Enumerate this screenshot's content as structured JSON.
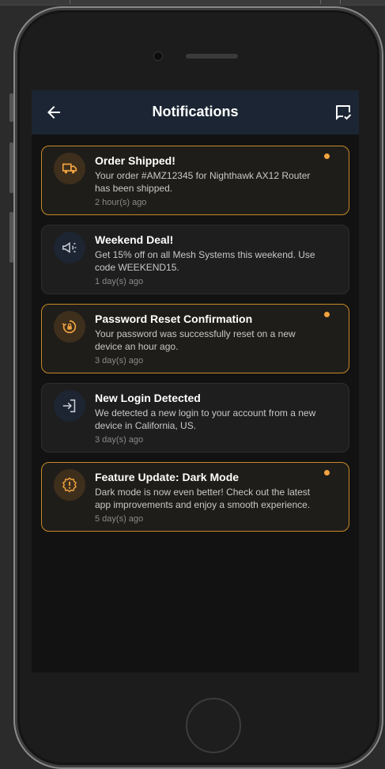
{
  "appbar": {
    "title": "Notifications",
    "back_icon": "arrow-left-icon",
    "mark_read_icon": "mark-chat-read-icon"
  },
  "colors": {
    "accent": "#f3a340",
    "appbar_bg": "#1b2533",
    "screen_bg": "#121212",
    "unread_border": "#c68a27"
  },
  "notifications": [
    {
      "title": "Order Shipped!",
      "body": "Your order #AMZ12345 for Nighthawk AX12 Router has been shipped.",
      "time": "2 hour(s) ago",
      "unread": true,
      "icon": "truck-icon"
    },
    {
      "title": "Weekend Deal!",
      "body": "Get 15% off on all Mesh Systems this weekend. Use code WEEKEND15.",
      "time": "1 day(s) ago",
      "unread": false,
      "icon": "megaphone-icon"
    },
    {
      "title": "Password Reset Confirmation",
      "body": "Your password was successfully reset on a new device an hour ago.",
      "time": "3 day(s) ago",
      "unread": true,
      "icon": "lock-reset-icon"
    },
    {
      "title": "New Login Detected",
      "body": "We detected a new login to your account from a new device in California, US.",
      "time": "3 day(s) ago",
      "unread": false,
      "icon": "login-icon"
    },
    {
      "title": "Feature Update: Dark Mode",
      "body": "Dark mode is now even better! Check out the latest app improvements and enjoy a smooth experience.",
      "time": "5 day(s) ago",
      "unread": true,
      "icon": "new-release-icon"
    }
  ]
}
